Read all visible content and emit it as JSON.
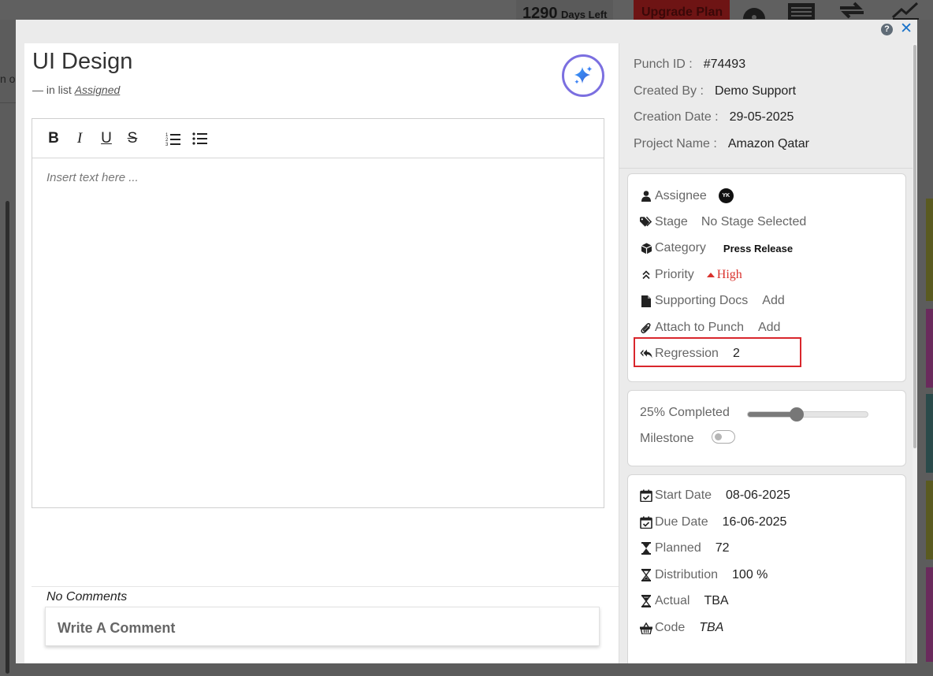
{
  "background": {
    "days_left_number": "1290",
    "days_left_label": "Days Left",
    "upgrade_label": "Upgrade Plan",
    "left_fragment": "n o"
  },
  "header": {
    "title": "UI Design",
    "list_prefix": "—  in list",
    "list_name": "Assigned"
  },
  "editor": {
    "placeholder": "Insert text here ...",
    "toolbar": [
      "bold",
      "italic",
      "underline",
      "strikethrough",
      "ordered-list",
      "unordered-list"
    ]
  },
  "comments": {
    "empty_label": "No Comments",
    "input_placeholder": "Write A Comment"
  },
  "info": {
    "punch_id_label": "Punch ID :",
    "punch_id": "#74493",
    "created_by_label": "Created By :",
    "created_by": "Demo Support",
    "creation_date_label": "Creation Date :",
    "creation_date": "29-05-2025",
    "project_name_label": "Project Name :",
    "project_name": "Amazon Qatar"
  },
  "details": {
    "assignee_label": "Assignee",
    "assignee_initials": "YK",
    "stage_label": "Stage",
    "stage_value": "No Stage Selected",
    "category_label": "Category",
    "category_value": "Press Release",
    "priority_label": "Priority",
    "priority_value": "High",
    "supporting_docs_label": "Supporting Docs",
    "supporting_docs_action": "Add",
    "attach_label": "Attach to Punch",
    "attach_action": "Add",
    "regression_label": "Regression",
    "regression_value": "2"
  },
  "progress": {
    "completed_label": "25% Completed",
    "completed_value": 0.25,
    "milestone_label": "Milestone",
    "milestone_on": false
  },
  "schedule": {
    "start_label": "Start Date",
    "start_value": "08-06-2025",
    "due_label": "Due Date",
    "due_value": "16-06-2025",
    "planned_label": "Planned",
    "planned_value": "72",
    "distribution_label": "Distribution",
    "distribution_value": "100 %",
    "actual_label": "Actual",
    "actual_value": "TBA",
    "code_label": "Code",
    "code_value": "TBA"
  },
  "colors": {
    "accent_blue": "#1a73c9",
    "priority_red": "#d9322d",
    "highlight_red": "#d9262c",
    "ai_gradient": "#7b6fe0"
  }
}
